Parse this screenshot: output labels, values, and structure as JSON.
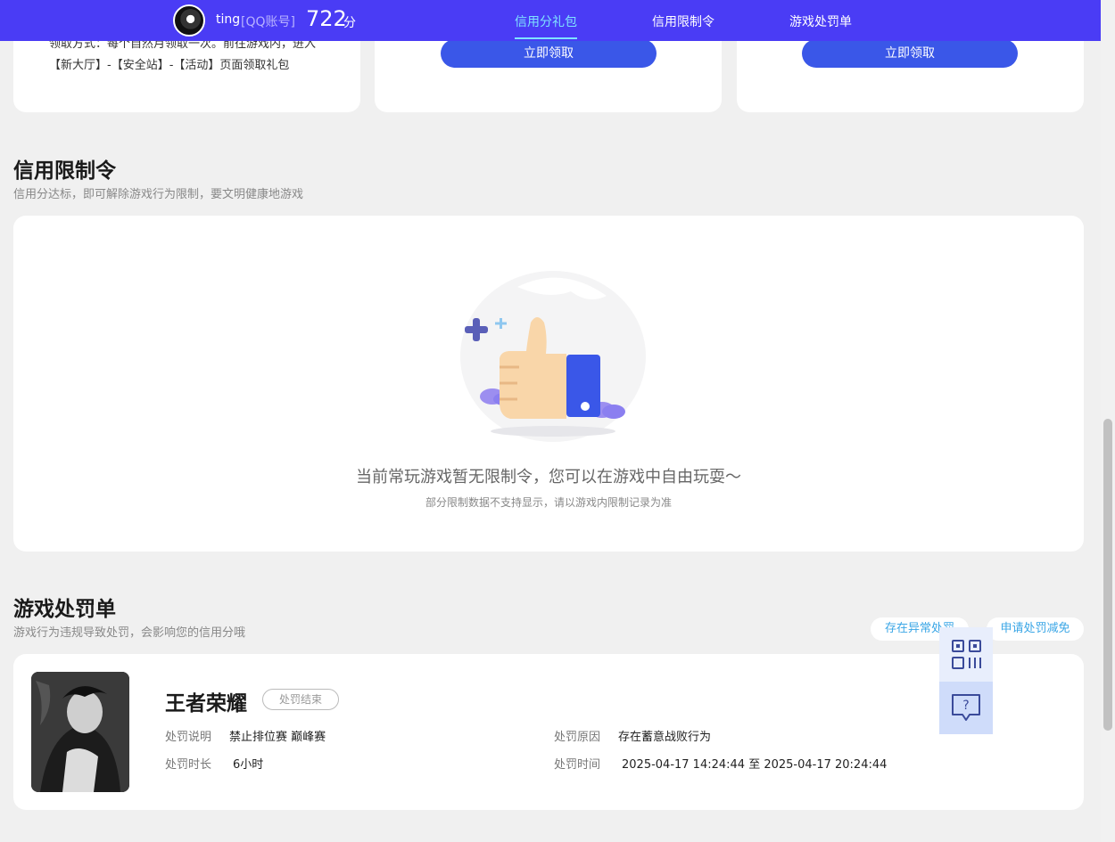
{
  "header": {
    "username": "ting",
    "account_type": "[QQ账号]",
    "score": "722",
    "score_unit": "分",
    "tabs": [
      {
        "label": "信用分礼包",
        "active": true
      },
      {
        "label": "信用限制令",
        "active": false
      },
      {
        "label": "游戏处罚单",
        "active": false
      }
    ],
    "bg_color": "#4a3cf5",
    "active_color": "#7fe3ff"
  },
  "gift_cards": {
    "claim_method": "领取方式：每个自然月领取一次。前往游戏内，进入【新大厅】-【安全站】-【活动】页面领取礼包",
    "claim_button_label": "立即领取"
  },
  "restriction": {
    "title": "信用限制令",
    "subtitle": "信用分达标，即可解除游戏行为限制，要文明健康地游戏",
    "empty_message": "当前常玩游戏暂无限制令，您可以在游戏中自由玩耍～",
    "empty_note": "部分限制数据不支持显示，请以游戏内限制记录为准"
  },
  "penalty": {
    "title": "游戏处罚单",
    "subtitle": "游戏行为违规导致处罚，会影响您的信用分哦",
    "filters": [
      "存在异常处罚",
      "申请处罚减免"
    ],
    "item": {
      "game_name": "王者荣耀",
      "status": "处罚结束",
      "desc_label": "处罚说明",
      "desc_value": "禁止排位赛 巅峰赛",
      "duration_label": "处罚时长",
      "duration_value": "6小时",
      "reason_label": "处罚原因",
      "reason_value": "存在蓄意战败行为",
      "time_label": "处罚时间",
      "time_value": "2025-04-17 14:24:44 至 2025-04-17 20:24:44"
    }
  },
  "float_widget": {
    "icons": [
      "qr-code-icon",
      "help-chat-icon"
    ]
  }
}
